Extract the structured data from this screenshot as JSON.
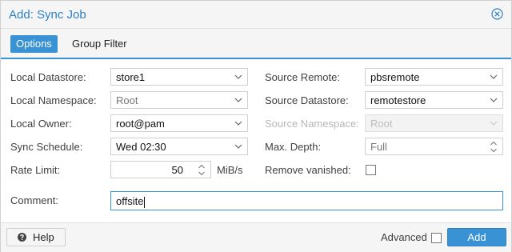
{
  "dialog": {
    "title": "Add: Sync Job"
  },
  "tabs": [
    {
      "label": "Options"
    },
    {
      "label": "Group Filter"
    }
  ],
  "form": {
    "local_datastore": {
      "label": "Local Datastore:",
      "value": "store1"
    },
    "local_namespace": {
      "label": "Local Namespace:",
      "value": "Root"
    },
    "local_owner": {
      "label": "Local Owner:",
      "value": "root@pam"
    },
    "sync_schedule": {
      "label": "Sync Schedule:",
      "value": "Wed 02:30"
    },
    "rate_limit": {
      "label": "Rate Limit:",
      "value": "50",
      "unit": "MiB/s"
    },
    "source_remote": {
      "label": "Source Remote:",
      "value": "pbsremote"
    },
    "source_datastore": {
      "label": "Source Datastore:",
      "value": "remotestore"
    },
    "source_namespace": {
      "label": "Source Namespace:",
      "value": "Root"
    },
    "max_depth": {
      "label": "Max. Depth:",
      "value": "Full"
    },
    "remove_vanished": {
      "label": "Remove vanished:",
      "checked": false
    },
    "comment": {
      "label": "Comment:",
      "value": "offsite"
    }
  },
  "footer": {
    "help_label": "Help",
    "advanced_label": "Advanced",
    "advanced_checked": false,
    "add_label": "Add"
  },
  "colors": {
    "accent": "#3892d4",
    "title": "#2f80c6",
    "disabled_text": "#b7b7b7"
  }
}
